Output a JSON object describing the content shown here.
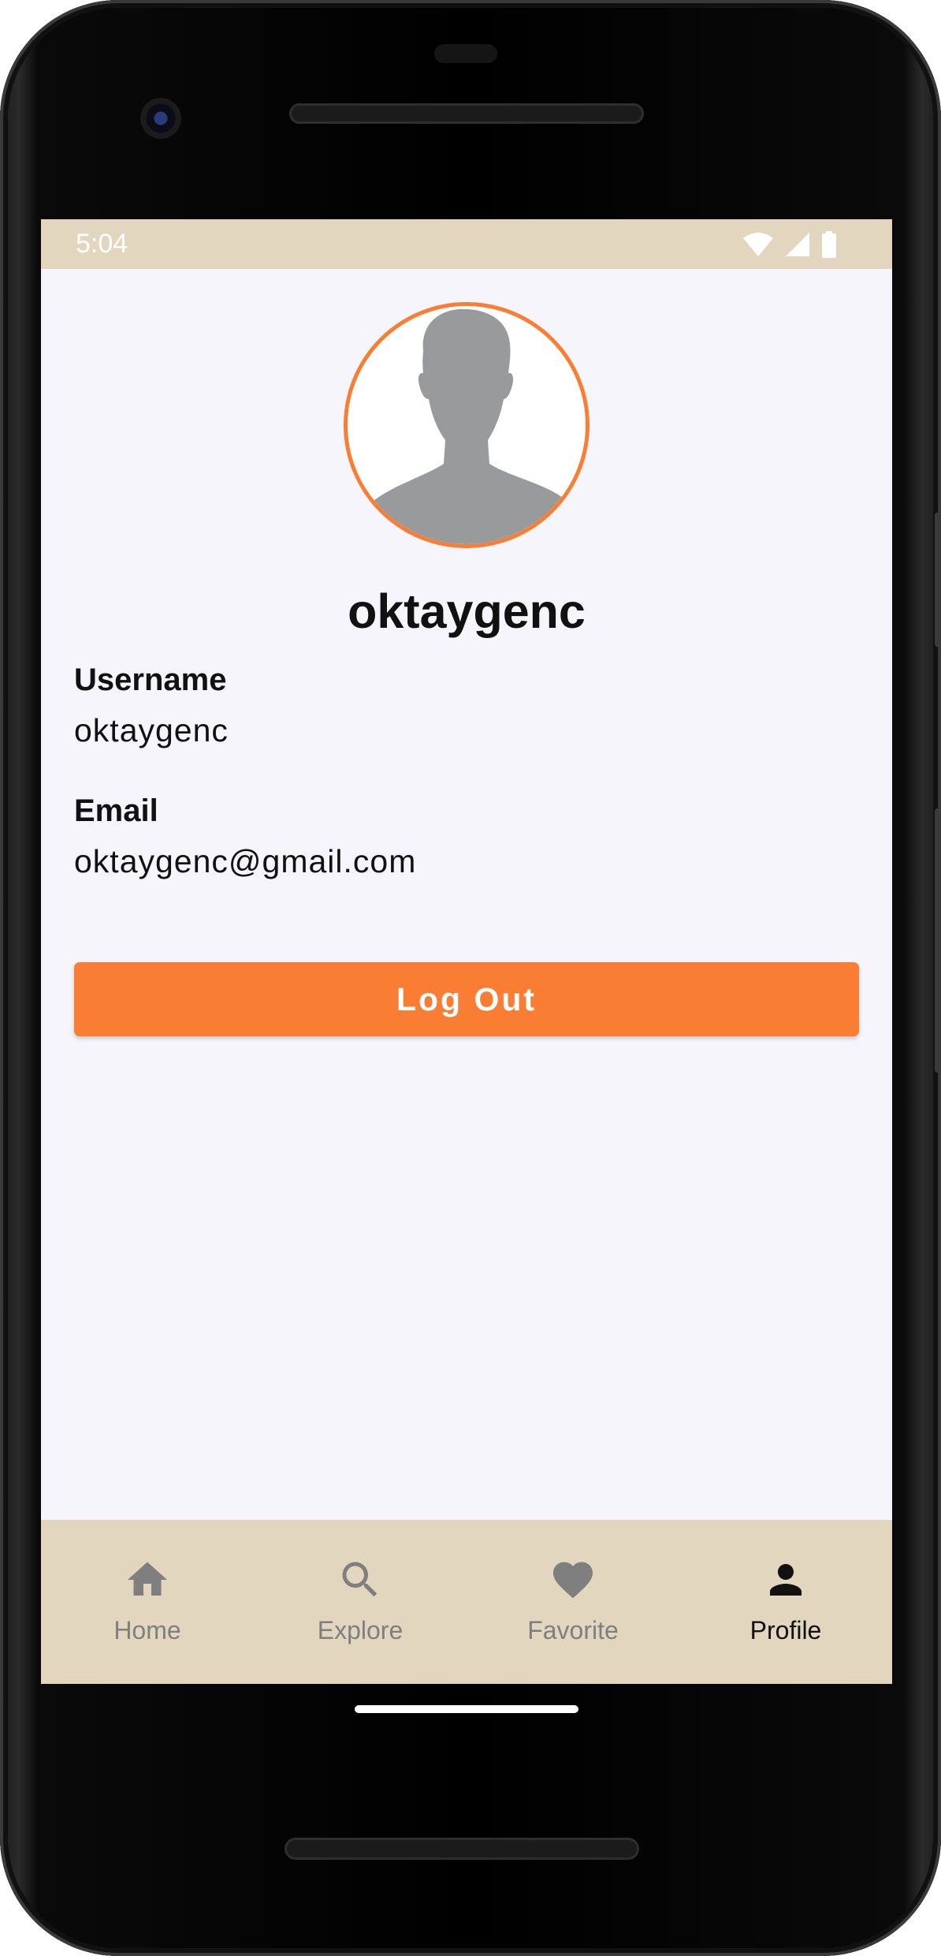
{
  "status_bar": {
    "time": "5:04",
    "icons": [
      "wifi-icon",
      "cell-signal-icon",
      "battery-icon"
    ]
  },
  "profile": {
    "avatar_icon": "person-silhouette-icon",
    "display_name": "oktaygenc",
    "fields": [
      {
        "label": "Username",
        "value": "oktaygenc"
      },
      {
        "label": "Email",
        "value": "oktaygenc@gmail.com"
      }
    ],
    "logout_label": "Log Out"
  },
  "bottom_nav": {
    "items": [
      {
        "label": "Home",
        "icon": "home-icon",
        "active": false
      },
      {
        "label": "Explore",
        "icon": "search-icon",
        "active": false
      },
      {
        "label": "Favorite",
        "icon": "heart-icon",
        "active": false
      },
      {
        "label": "Profile",
        "icon": "person-icon",
        "active": true
      }
    ]
  },
  "colors": {
    "accent": "#f97e33",
    "bar_background": "#e2d6bf",
    "screen_background": "#f7f5fc",
    "inactive_nav": "#7f7f7f",
    "active_nav": "#111111"
  }
}
